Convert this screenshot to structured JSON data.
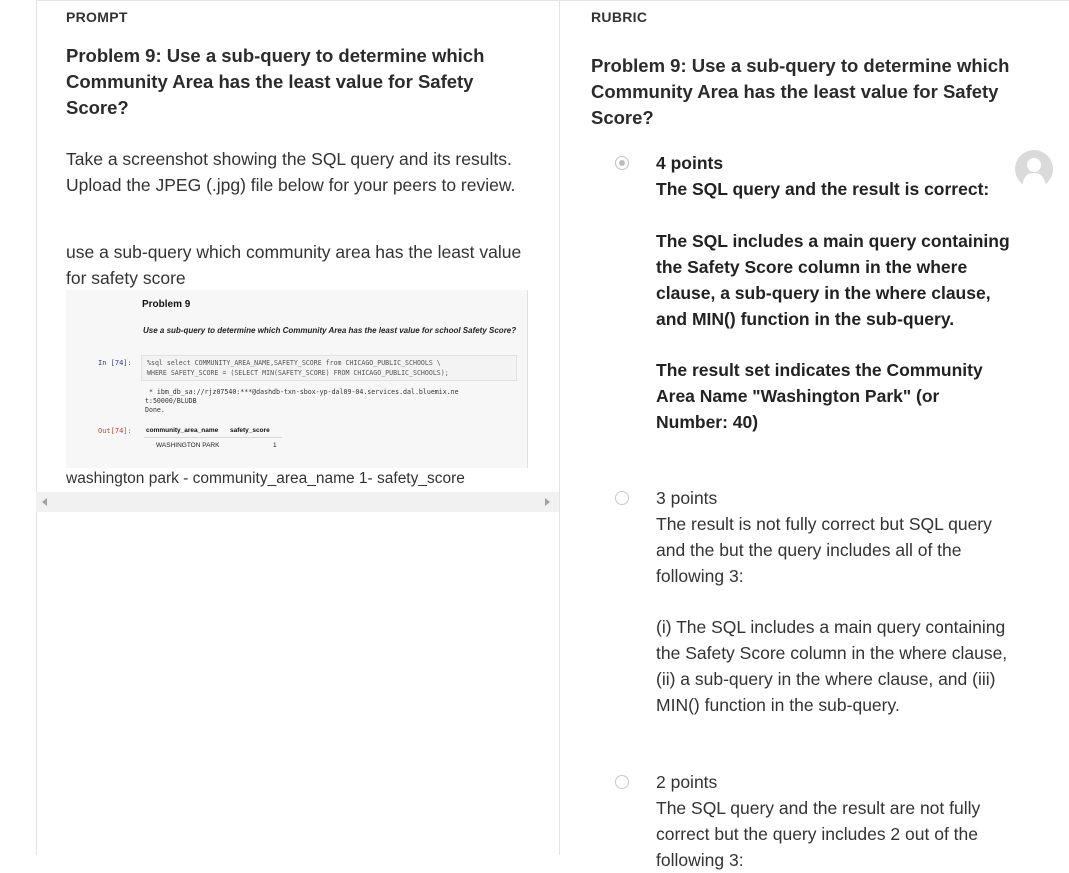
{
  "prompt": {
    "section_label": "PROMPT",
    "question_title": "Problem 9: Use a sub-query to determine which Community Area has the least value for Safety Score?",
    "instructions": "Take a screenshot showing the SQL query and its results. Upload the JPEG (.jpg) file below for your peers to review.",
    "answer_text": "use a sub-query which community area has the least value for safety score",
    "notebook": {
      "heading": "Problem 9",
      "description": "Use a sub-query to determine which Community Area has the least value for school Safety Score?",
      "in_prompt": "In [74]:",
      "code_line_1": "%sql select COMMUNITY_AREA_NAME,SAFETY_SCORE from CHICAGO_PUBLIC_SCHOOLS \\",
      "code_line_2": "WHERE SAFETY_SCORE = (SELECT MIN(SAFETY_SCORE) FROM CHICAGO_PUBLIC_SCHOOLS);",
      "output_line_1": " * ibm_db_sa://rjz07540:***@dashdb-txn-sbox-yp-dal09-04.services.dal.bluemix.ne",
      "output_line_2": "t:50000/BLUDB",
      "output_line_3": "Done.",
      "out_prompt": "Out[74]:",
      "columns": [
        "community_area_name",
        "safety_score"
      ],
      "row": [
        "WASHINGTON PARK",
        "1"
      ]
    },
    "caption": "washington park - community_area_name 1- safety_score"
  },
  "rubric": {
    "section_label": "RUBRIC",
    "question_title": "Problem 9: Use a sub-query to determine which Community Area has the least value for Safety Score?",
    "options": [
      {
        "points": "4 points",
        "selected": true,
        "paragraphs": [
          "The SQL query and the result is correct:",
          "The SQL includes a main query containing the Safety Score column in the where clause, a sub-query in the where clause, and MIN() function in the sub-query.",
          "The result set indicates the Community Area Name \"Washington Park\" (or Number: 40)"
        ]
      },
      {
        "points": "3 points",
        "selected": false,
        "paragraphs": [
          "The result is not fully correct but SQL query and the but the query includes all of the following 3:",
          "(i) The SQL includes a main query containing the Safety Score column in the where clause, (ii) a sub-query in the where clause, and (iii) MIN() function in the sub-query."
        ]
      },
      {
        "points": "2 points",
        "selected": false,
        "paragraphs": [
          "The SQL query and the result are not fully correct but the query includes 2 out of the following 3:"
        ]
      }
    ]
  },
  "icons": {
    "avatar": "user-avatar-icon",
    "scroll_left": "scroll-left-arrow-icon",
    "scroll_right": "scroll-right-arrow-icon"
  }
}
